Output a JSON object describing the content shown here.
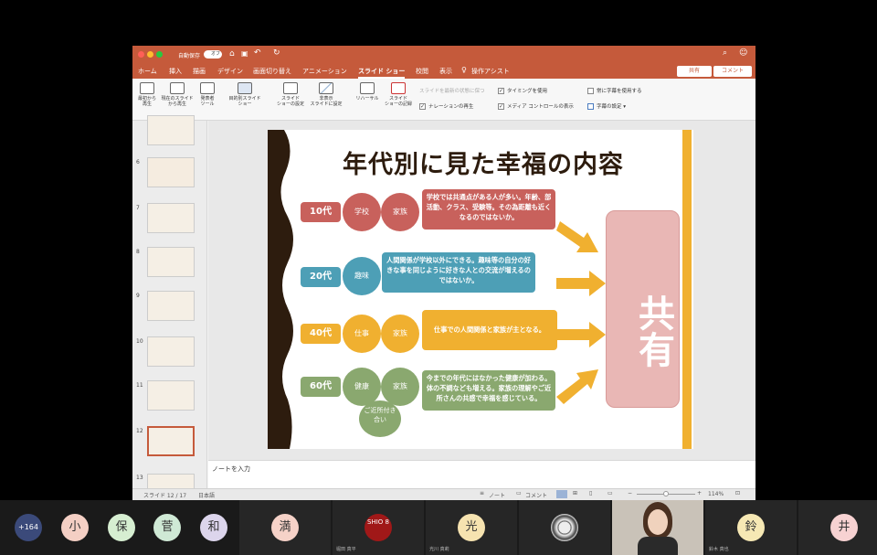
{
  "titlebar": {
    "autosave": "自動保存",
    "toggle": "オフ"
  },
  "tabs": [
    "ホーム",
    "挿入",
    "描画",
    "デザイン",
    "画面切り替え",
    "アニメーション",
    "スライド ショー",
    "校閲",
    "表示",
    "操作アシスト"
  ],
  "share": "共有",
  "comment": "コメント",
  "ribbon": {
    "b1": "最初から\n再生",
    "b2": "現在のスライド\nから再生",
    "b3": "発表者\nツール",
    "b4": "目的別スライド\nショー",
    "b5": "スライド\nショーの設定",
    "b6": "非表示\nスライドに設定",
    "b7": "リハーサル",
    "b8": "スライド\nショーの記録",
    "c1": "スライドを最新の状態に保つ",
    "c2": "ナレーションの再生",
    "c3": "タイミングを使用",
    "c4": "メディア コントロールの表示",
    "c5": "常に字幕を使用する",
    "c6": "字幕の設定"
  },
  "thumbs": [
    "6",
    "7",
    "8",
    "9",
    "10",
    "11",
    "12",
    "13"
  ],
  "slide": {
    "title": "年代別に見た幸福の内容",
    "rows": [
      {
        "age": "10代",
        "c1": "学校",
        "c2": "家族",
        "desc": "学校では共通点がある人が多い。年齢、部活動、クラス、受験等。その為距離も近くなるのではないか。"
      },
      {
        "age": "20代",
        "c1": "趣味",
        "desc": "人間関係が学校以外にできる。趣味等の自分の好きな事を同じように好きな人との交流が増えるのではないか。"
      },
      {
        "age": "40代",
        "c1": "仕事",
        "c2": "家族",
        "desc": "仕事での人間関係と家族が主となる。"
      },
      {
        "age": "60代",
        "c1": "健康",
        "c2": "家族",
        "c3": "ご近所付き合い",
        "desc": "今までの年代にはなかった健康が加わる。体の不調なども増える。家族の理解やご近所さんの共感で幸福を感じている。"
      }
    ],
    "box": "共有"
  },
  "notes_placeholder": "ノートを入力",
  "status": {
    "slide": "スライド 12 / 17",
    "lang": "日本語",
    "notes": "ノート",
    "comments": "コメント",
    "zoom": "114%"
  },
  "participants": {
    "count": "+164",
    "circles": [
      "小",
      "保",
      "菅",
      "和"
    ],
    "tiles": [
      {
        "avatar": "満",
        "name": ""
      },
      {
        "avatar": "SHIO 8",
        "name": "堀田 真平"
      },
      {
        "avatar": "光",
        "name": "光川 真莉"
      },
      {
        "avatar": "",
        "name": ""
      },
      {
        "avatar": "",
        "name": ""
      },
      {
        "avatar": "鈴",
        "name": "鈴木 真也"
      },
      {
        "avatar": "井",
        "name": ""
      }
    ]
  },
  "colors": {
    "accent": "#c55a3b",
    "red": "#c8615c",
    "blue": "#4d9fb6",
    "yellow": "#f0b030",
    "green": "#8aa86f",
    "pink": "#e9b7b5"
  }
}
